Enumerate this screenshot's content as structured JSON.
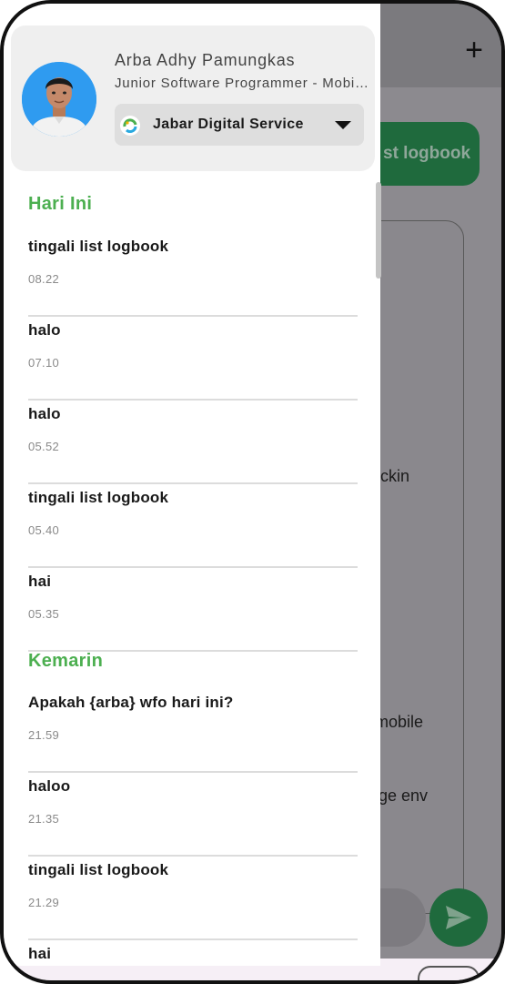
{
  "background": {
    "action_label": "st logbook",
    "snippets": [
      "ckin",
      "mobile",
      "ge env"
    ],
    "add_icon": "plus-icon",
    "send_icon": "send-icon"
  },
  "drawer": {
    "user": {
      "name": "Arba Adhy Pamungkas",
      "role": "Junior Software Programmer - Mobile Developer"
    },
    "organization": {
      "name": "Jabar Digital Service",
      "icon": "jds-logo-icon"
    },
    "sections": [
      {
        "title": "Hari Ini",
        "items": [
          {
            "title": "tingali list logbook",
            "time": "08.22"
          },
          {
            "title": "halo",
            "time": "07.10"
          },
          {
            "title": "halo",
            "time": "05.52"
          },
          {
            "title": "tingali list logbook",
            "time": "05.40"
          },
          {
            "title": "hai",
            "time": "05.35"
          }
        ]
      },
      {
        "title": "Kemarin",
        "items": [
          {
            "title": "Apakah {arba} wfo hari ini?",
            "time": "21.59"
          },
          {
            "title": "haloo",
            "time": "21.35"
          },
          {
            "title": "tingali list logbook",
            "time": "21.29"
          },
          {
            "title": "hai",
            "time": ""
          }
        ]
      }
    ]
  },
  "colors": {
    "accent_green": "#4caf50",
    "primary_green": "#1f6a3d",
    "scrim": "#8c8a8f"
  }
}
